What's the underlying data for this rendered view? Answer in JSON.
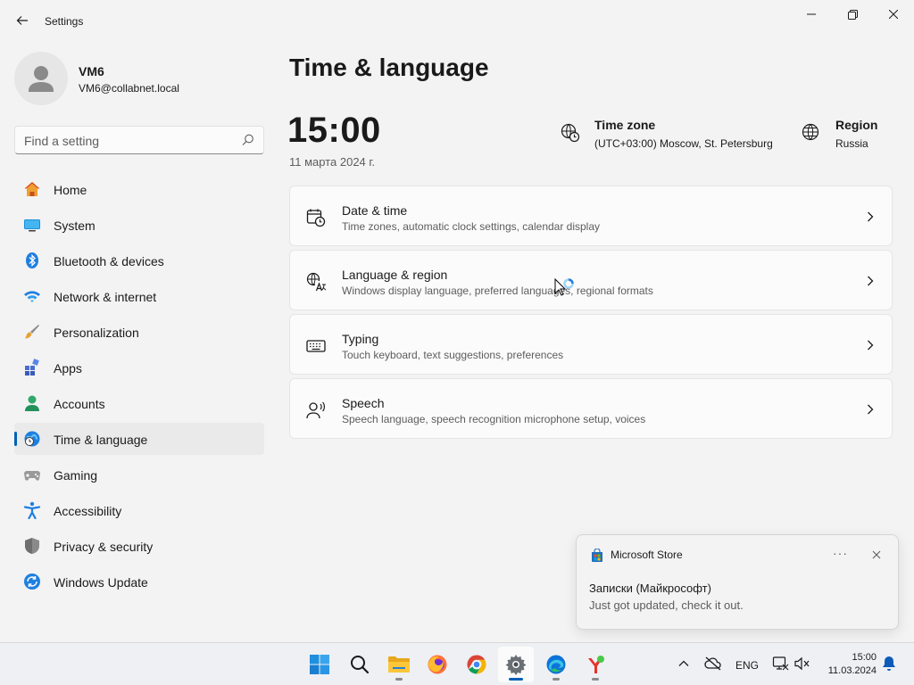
{
  "window": {
    "title": "Settings"
  },
  "profile": {
    "name": "VM6",
    "email": "VM6@collabnet.local"
  },
  "search": {
    "placeholder": "Find a setting",
    "value": ""
  },
  "sidebar": {
    "items": [
      {
        "label": "Home",
        "icon": "home-icon",
        "active": false
      },
      {
        "label": "System",
        "icon": "system-icon",
        "active": false
      },
      {
        "label": "Bluetooth & devices",
        "icon": "bluetooth-icon",
        "active": false
      },
      {
        "label": "Network & internet",
        "icon": "wifi-icon",
        "active": false
      },
      {
        "label": "Personalization",
        "icon": "brush-icon",
        "active": false
      },
      {
        "label": "Apps",
        "icon": "apps-icon",
        "active": false
      },
      {
        "label": "Accounts",
        "icon": "accounts-icon",
        "active": false
      },
      {
        "label": "Time & language",
        "icon": "globe-clock-icon",
        "active": true
      },
      {
        "label": "Gaming",
        "icon": "gamepad-icon",
        "active": false
      },
      {
        "label": "Accessibility",
        "icon": "accessibility-icon",
        "active": false
      },
      {
        "label": "Privacy & security",
        "icon": "shield-icon",
        "active": false
      },
      {
        "label": "Windows Update",
        "icon": "update-icon",
        "active": false
      }
    ]
  },
  "main": {
    "title": "Time & language",
    "time": "15:00",
    "date": "11 марта 2024 г.",
    "timezone": {
      "label": "Time zone",
      "value": "(UTC+03:00) Moscow, St. Petersburg"
    },
    "region": {
      "label": "Region",
      "value": "Russia"
    },
    "cards": [
      {
        "title": "Date & time",
        "subtitle": "Time zones, automatic clock settings, calendar display",
        "icon": "calendar-clock-icon"
      },
      {
        "title": "Language & region",
        "subtitle": "Windows display language, preferred languages, regional formats",
        "icon": "language-icon"
      },
      {
        "title": "Typing",
        "subtitle": "Touch keyboard, text suggestions, preferences",
        "icon": "keyboard-icon"
      },
      {
        "title": "Speech",
        "subtitle": "Speech language, speech recognition microphone setup, voices",
        "icon": "speech-icon"
      }
    ]
  },
  "toast": {
    "app": "Microsoft Store",
    "more": "···",
    "title": "Записки (Майкрософт)",
    "body": "Just got updated, check it out."
  },
  "taskbar": {
    "apps": [
      "start-icon",
      "search-icon",
      "file-explorer-icon",
      "firefox-icon",
      "chrome-icon",
      "settings-icon",
      "edge-icon",
      "yandex-icon"
    ],
    "language": "ENG",
    "clock_time": "15:00",
    "clock_date": "11.03.2024"
  },
  "colors": {
    "accent": "#005fb8",
    "background": "#f3f3f3",
    "card": "#fbfbfb"
  }
}
